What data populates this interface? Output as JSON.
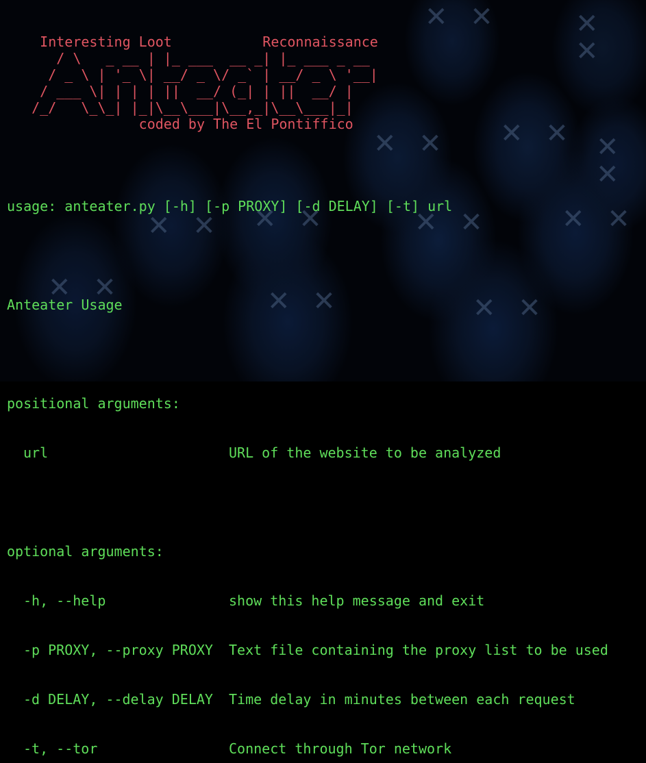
{
  "banner": {
    "line1": "    Interesting Loot           Reconnaissance",
    "line2": "      / \\   _ __ | |_ ___  __ _| |_ ___ _ __",
    "line3": "     / _ \\ | '_ \\| __/ _ \\/ _` | __/ _ \\ '__|",
    "line4": "    / ___ \\| | | | ||  __/ (_| | ||  __/ |",
    "line5": "   /_/   \\_\\_| |_|\\__\\___|\\__,_|\\__\\___|_|",
    "line6": "                coded by The El Pontiffico"
  },
  "help": {
    "usage": "usage: anteater.py [-h] [-p PROXY] [-d DELAY] [-t] url",
    "description": "Anteater Usage",
    "positional_header": "positional arguments:",
    "positional": [
      {
        "flag": "url",
        "desc": "URL of the website to be analyzed"
      }
    ],
    "optional_header": "optional arguments:",
    "optional": [
      {
        "flag": "-h, --help",
        "desc": "show this help message and exit"
      },
      {
        "flag": "-p PROXY, --proxy PROXY",
        "desc": "Text file containing the proxy list to be used"
      },
      {
        "flag": "-d DELAY, --delay DELAY",
        "desc": "Time delay in minutes between each request"
      },
      {
        "flag": "-t, --tor",
        "desc": "Connect through Tor network"
      }
    ]
  },
  "colors": {
    "banner": "#e05561",
    "text": "#5fde5a",
    "background": "#020409"
  },
  "background_icons": [
    "hooded-figure-icon",
    "x-eyes-icon"
  ]
}
